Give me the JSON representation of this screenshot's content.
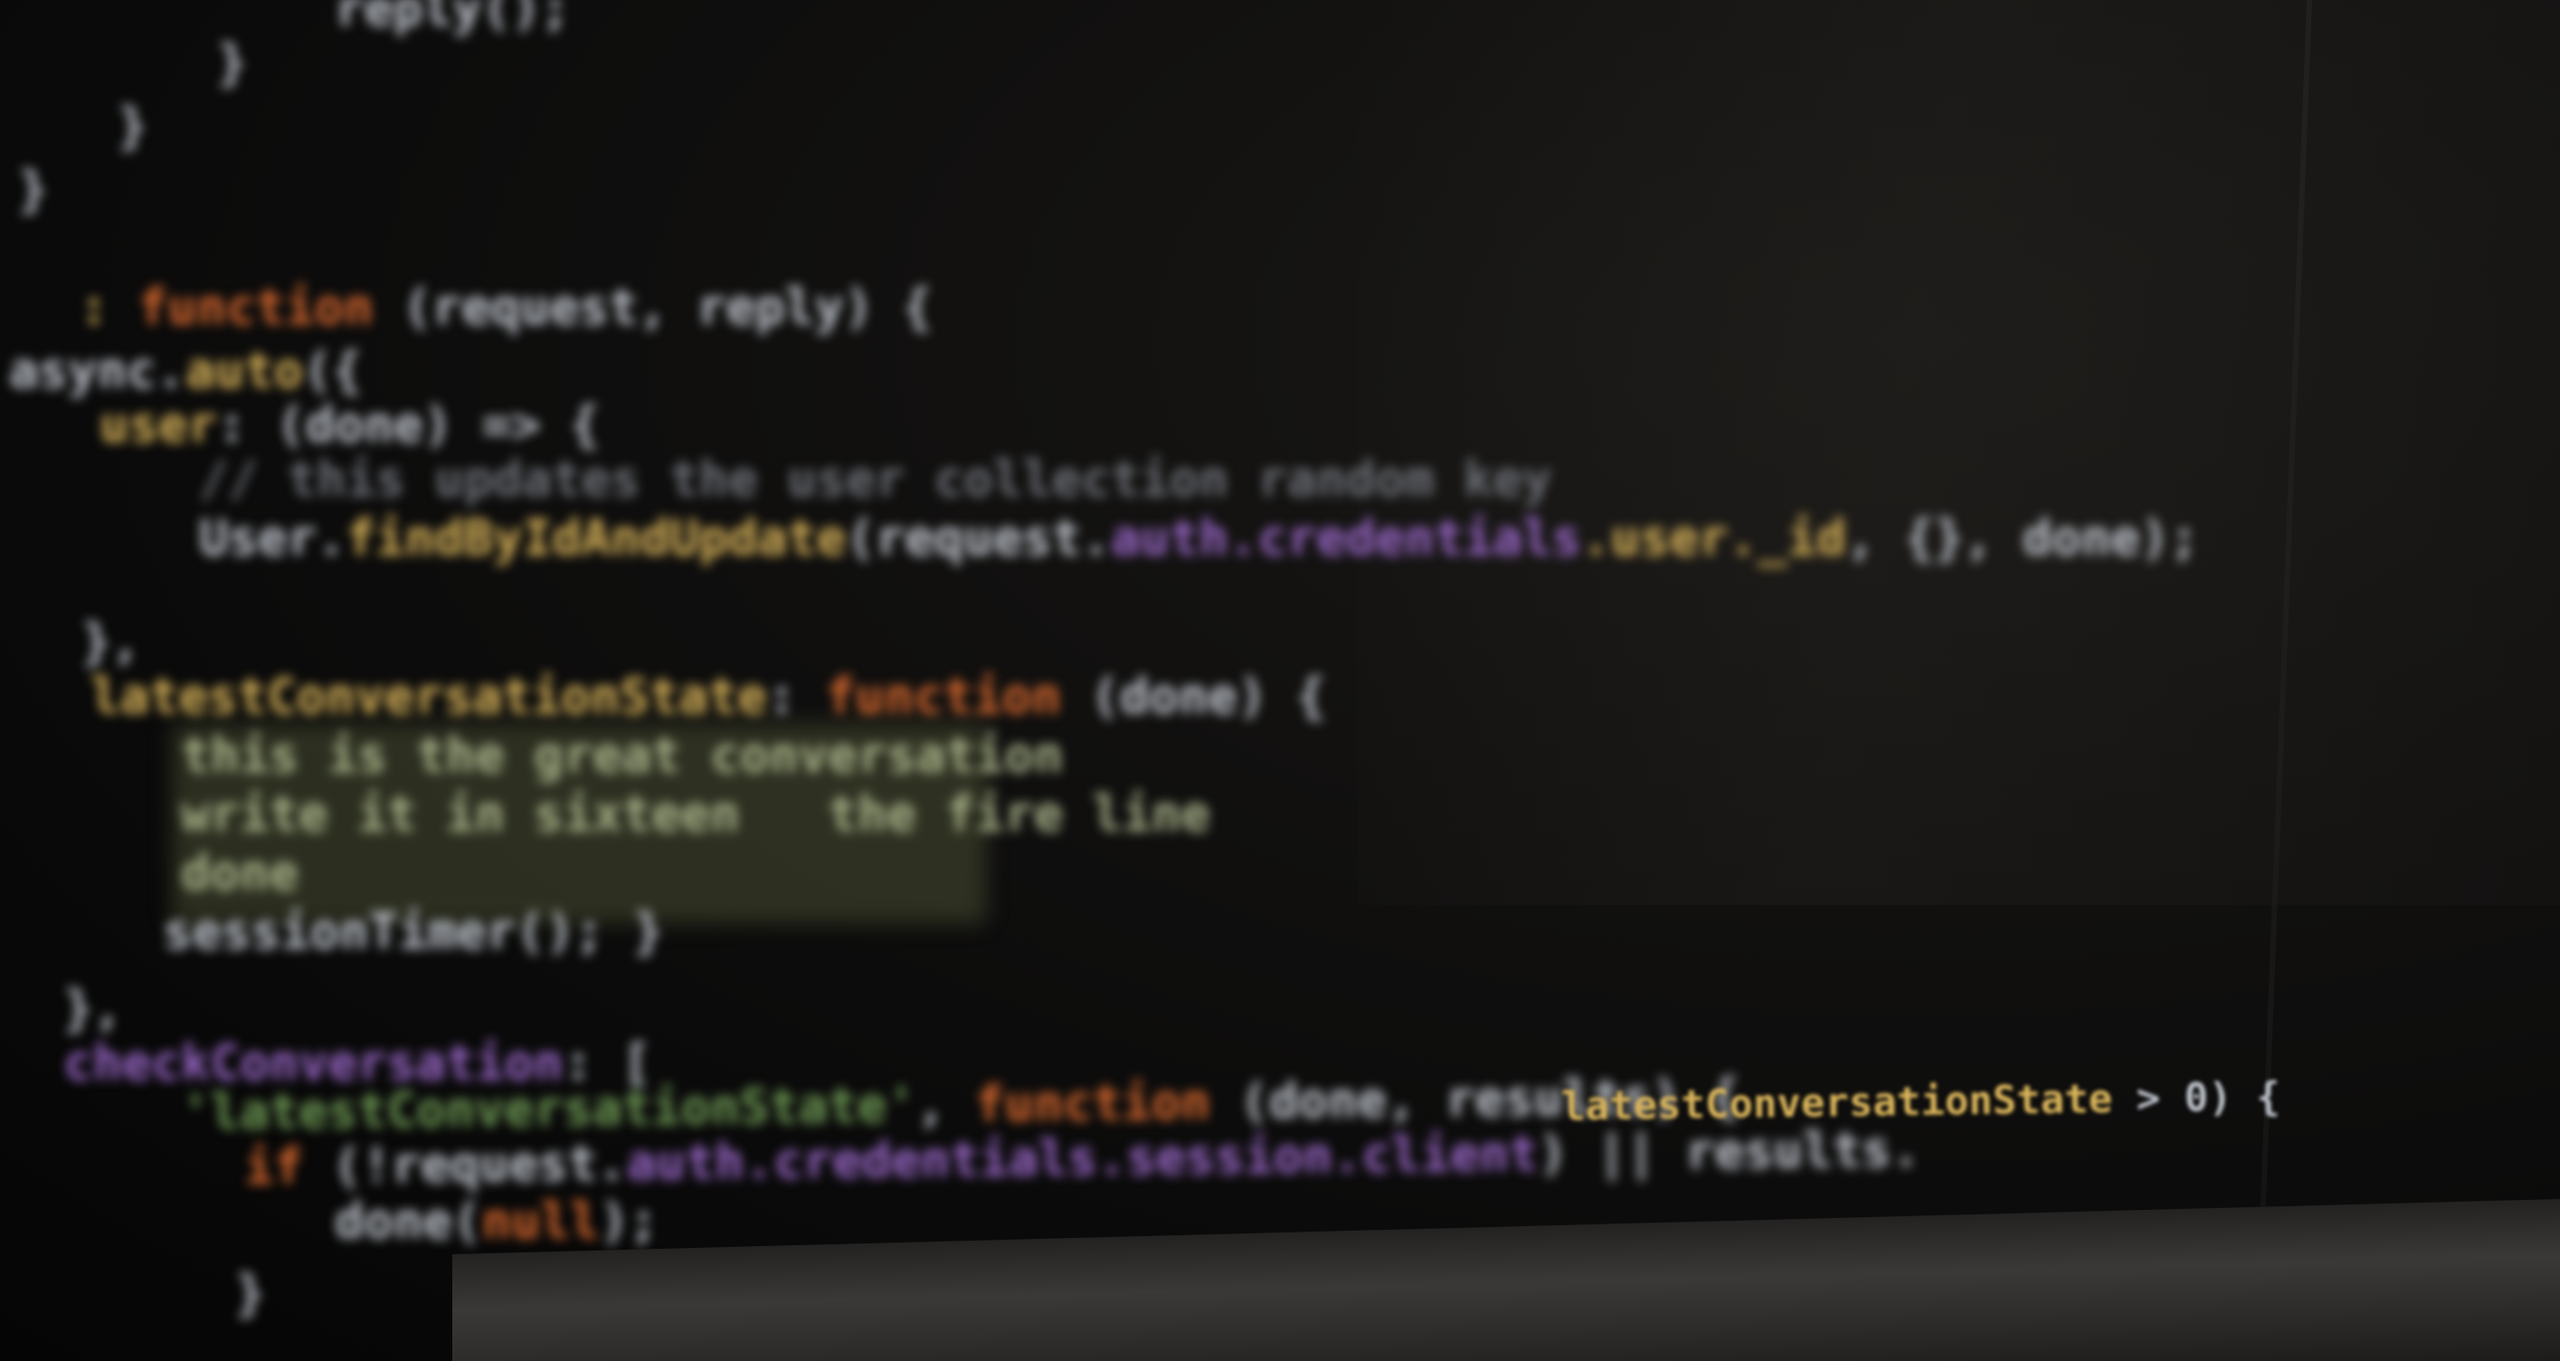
{
  "scene": {
    "description_free": true,
    "blur": "heavy",
    "background": "#070707",
    "palette": {
      "default": "#bfc4cc",
      "keyword": "#d8692f",
      "property": "#d9b45a",
      "purple": "#9a68c8",
      "comment": "#6e7178",
      "string": "#a9b38a"
    }
  },
  "code": {
    "line_1": "latestConversationState",
    "line_2": ">",
    "line_3": "0) {"
  }
}
